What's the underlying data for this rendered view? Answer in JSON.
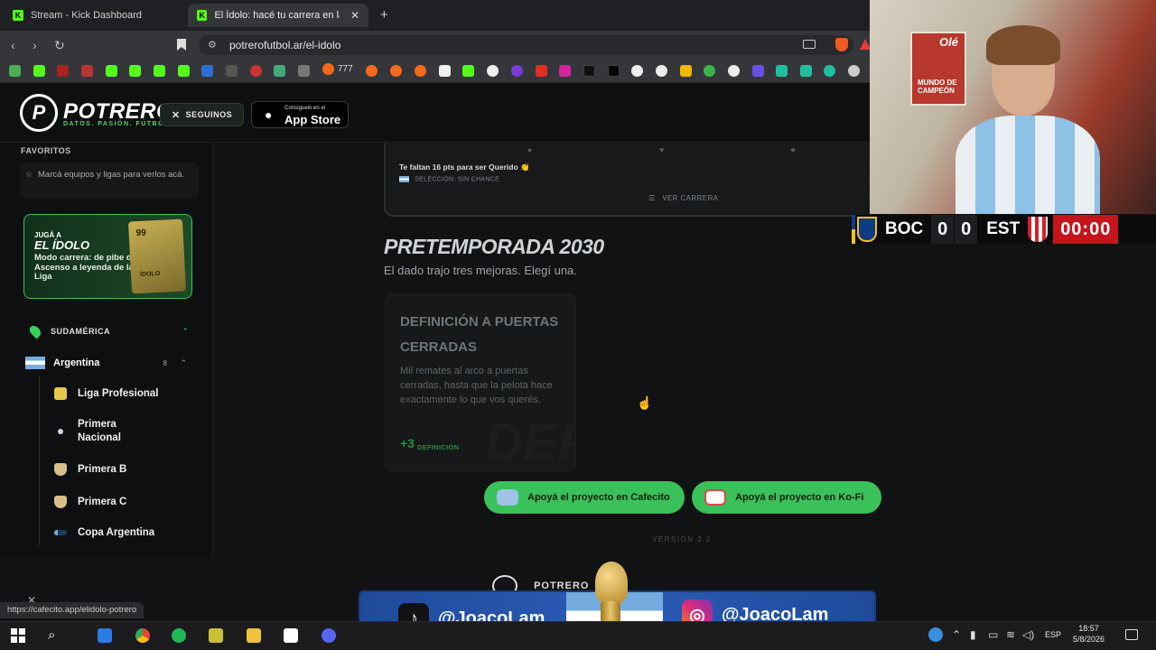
{
  "browser": {
    "tabs": [
      {
        "label": "Stream - Kick Dashboard",
        "active": false
      },
      {
        "label": "El Ídolo: hacé tu carrera en la Lig",
        "active": true
      }
    ],
    "url": "potrerofutbol.ar/el-idolo",
    "bookmark_text": "777",
    "status_url": "https://cafecito.app/elidolo-potrero"
  },
  "site": {
    "logo_text": "POTRERO",
    "logo_tag": "DATOS. PASIÓN. FÚTBOL.",
    "follow_label": "SEGUINOS",
    "appstore_small": "Consíguelo en el",
    "appstore_big": "App Store"
  },
  "sidebar": {
    "favorites_title": "FAVORITOS",
    "favorites_hint": "Marcá equipos y ligas para verlos acá.",
    "promo": {
      "line1": "JUGÁ A",
      "line2": "EL ÍDOLO",
      "desc": "Modo carrera: de pibe del Ascenso a leyenda de la Liga",
      "card_number": "99",
      "card_name": "ÍDOLO"
    },
    "region": "SUDAMÉRICA",
    "country": "Argentina",
    "country_count": "8",
    "leagues": [
      "Liga Profesional",
      "Primera Nacional",
      "Primera B",
      "Primera C",
      "Copa Argentina"
    ]
  },
  "main": {
    "pts_text": "Te faltan 16 pts para ser Querido 👏",
    "pts_sub": "SELECCIÓN: SIN CHANCE",
    "ver_carrera": "VER CARRERA",
    "season_title": "PRETEMPORADA 2030",
    "season_sub": "El dado trajo tres mejoras. Elegí una.",
    "upgrade": {
      "title": "DEFINICIÓN A PUERTAS CERRADAS",
      "desc": "Mil remates al arco a puertas cerradas, hasta que la pelota hace exactamente lo que vos querés.",
      "bonus": "+3",
      "bonus_label": "DEFINICIÓN",
      "bg_text": "DEF"
    },
    "donate_cafecito": "Apoyá el proyecto en Cafecito",
    "donate_kofi": "Apoyá el proyecto en Ko-Fi",
    "version": "VERSIÓN 2.2",
    "footer_logo": "POTRERO"
  },
  "overlay": {
    "team_home": "BOC",
    "score_home_a": "0",
    "score_home_b": "0",
    "team_away": "EST",
    "clock": "00:00",
    "tiktok": "@JoacoLam",
    "instagram": "@JoacoLam",
    "poster_top": "Olé",
    "poster_text": "MUNDO DE CAMPEÓN"
  },
  "taskbar": {
    "lang": "ESP",
    "time": "18:57",
    "date": "5/8/2026"
  },
  "colors": {
    "accent_green": "#3ac15a",
    "bg_dark": "#111214",
    "kick_green": "#53fc18"
  }
}
